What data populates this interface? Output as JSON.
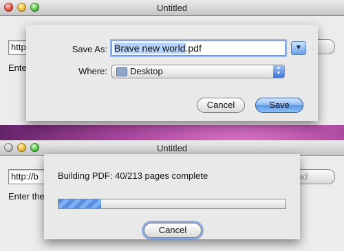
{
  "top_window": {
    "title": "Untitled",
    "url_value": "http:",
    "description": "Ente",
    "save_sheet": {
      "save_as_label": "Save As:",
      "filename_selected": "Brave new world",
      "filename_ext": ".pdf",
      "where_label": "Where:",
      "where_value": "Desktop",
      "cancel_label": "Cancel",
      "save_label": "Save"
    }
  },
  "bottom_window": {
    "title": "Untitled",
    "url_value": "http://b",
    "description": "Enter the",
    "download_label": "Download",
    "progress_sheet": {
      "status_text": "Building PDF: 40/213 pages complete",
      "progress_percent": 18.8,
      "cancel_label": "Cancel"
    }
  },
  "icons": {
    "expand": "triangle-down-icon",
    "folder": "folder-icon",
    "popup_arrows": "updown-arrows-icon"
  }
}
